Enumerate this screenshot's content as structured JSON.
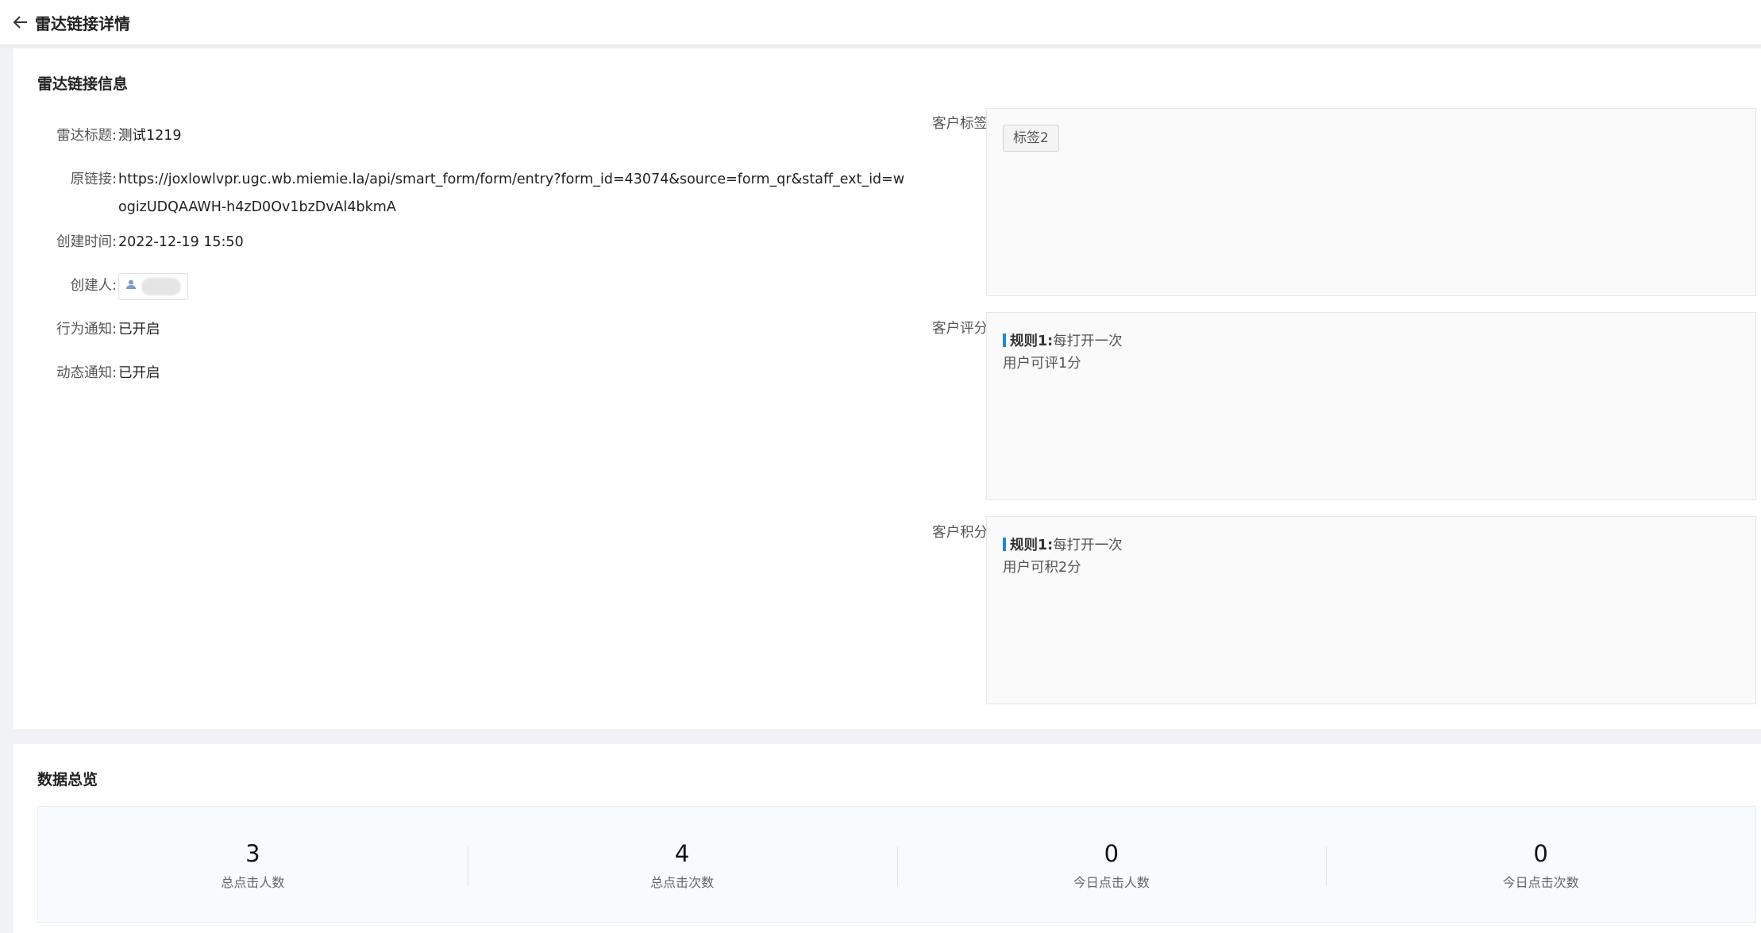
{
  "header": {
    "title": "雷达链接详情"
  },
  "info": {
    "section_title": "雷达链接信息",
    "fields": [
      {
        "label": "雷达标题:",
        "value": "测试1219"
      },
      {
        "label": "原链接:",
        "value": "https://joxlowlvpr.ugc.wb.miemie.la/api/smart_form/form/entry?form_id=43074&source=form_qr&staff_ext_id=wogizUDQAAWH-h4zD0Ov1bzDvAl4bkmA"
      },
      {
        "label": "创建时间:",
        "value": "2022-12-19 15:50"
      },
      {
        "label": "创建人:",
        "value": ""
      },
      {
        "label": "行为通知:",
        "value": "已开启"
      },
      {
        "label": "动态通知:",
        "value": "已开启"
      }
    ],
    "tags": {
      "label": "客户标签:",
      "items": [
        "标签2"
      ]
    },
    "score": {
      "label": "客户评分:",
      "rule_name": "规则1:",
      "rule_line1": "每打开一次",
      "rule_line2": "用户可评1分"
    },
    "points": {
      "label": "客户积分:",
      "rule_name": "规则1:",
      "rule_line1": "每打开一次",
      "rule_line2": "用户可积2分"
    }
  },
  "overview": {
    "section_title": "数据总览",
    "stats": [
      {
        "value": "3",
        "label": "总点击人数"
      },
      {
        "value": "4",
        "label": "总点击次数"
      },
      {
        "value": "0",
        "label": "今日点击人数"
      },
      {
        "value": "0",
        "label": "今日点击次数"
      }
    ]
  },
  "colors": {
    "accent": "#1e88e5",
    "page_bg": "#f0f2f5"
  },
  "icons": {
    "back": "arrow-left-icon",
    "creator": "user-icon"
  }
}
